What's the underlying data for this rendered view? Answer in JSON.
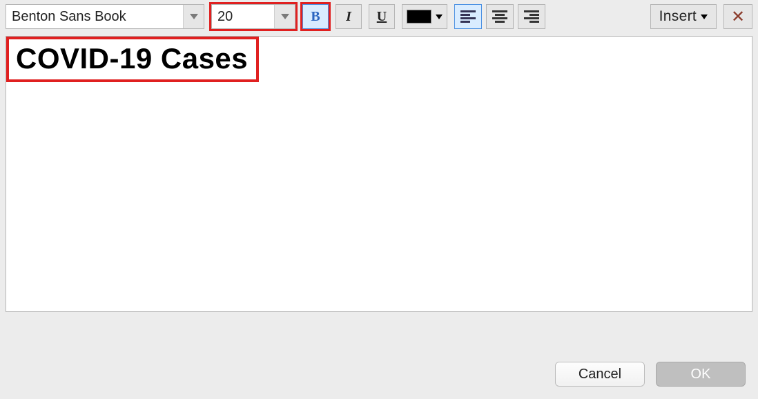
{
  "toolbar": {
    "font_name": "Benton Sans Book",
    "font_size": "20",
    "bold_label": "B",
    "italic_label": "I",
    "underline_label": "U",
    "insert_label": "Insert",
    "close_label": "✕"
  },
  "editor": {
    "title_text": "COVID-19 Cases"
  },
  "footer": {
    "cancel_label": "Cancel",
    "ok_label": "OK"
  },
  "colors": {
    "text_color": "#000000",
    "highlight": "#e02020"
  }
}
